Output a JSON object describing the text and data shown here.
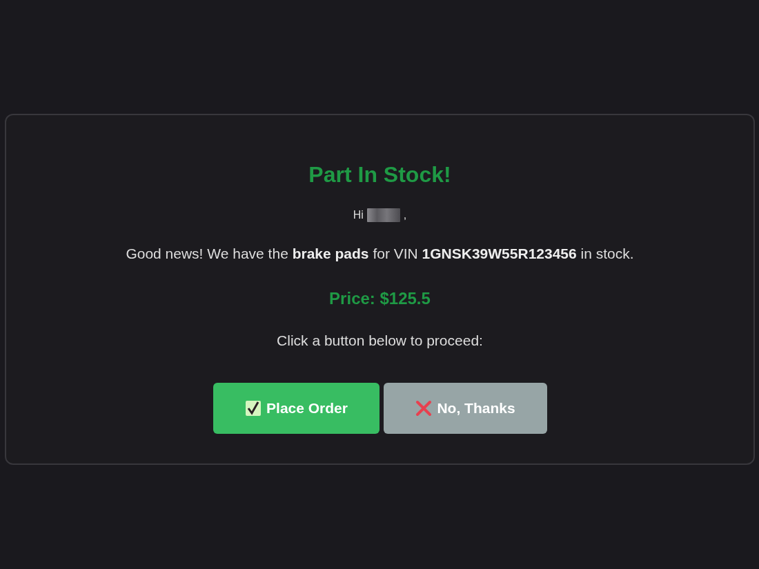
{
  "card": {
    "title": "Part In Stock!",
    "greeting": {
      "before": "Hi",
      "after": ","
    },
    "message": "Good news! We have the **brake pads** for VIN **1GNSK39W55R123456** in stock.",
    "price": "Price: $125.5",
    "prompt": "Click a button below to proceed:",
    "buttons": [
      {
        "kind": "confirm",
        "label": "Place Order"
      },
      {
        "kind": "decline",
        "label": "No, Thanks"
      }
    ]
  }
}
